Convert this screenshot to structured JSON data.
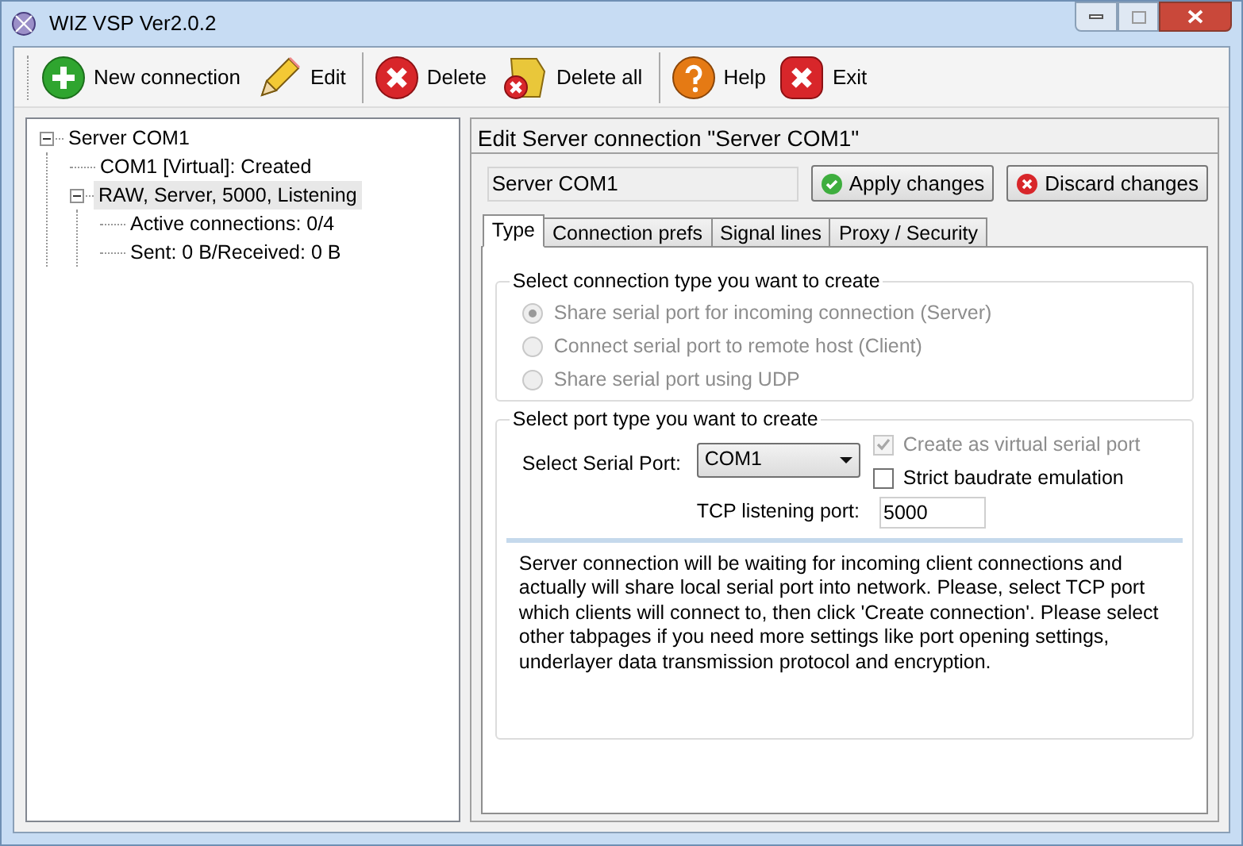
{
  "window": {
    "title": "WIZ VSP Ver2.0.2"
  },
  "toolbar": [
    {
      "label": "New connection",
      "kind": "add",
      "separator_after": false
    },
    {
      "label": "Edit",
      "kind": "edit",
      "separator_after": true
    },
    {
      "label": "Delete",
      "kind": "delete",
      "separator_after": false
    },
    {
      "label": "Delete all",
      "kind": "delete_all",
      "separator_after": true
    },
    {
      "label": "Help",
      "kind": "help",
      "separator_after": false
    },
    {
      "label": "Exit",
      "kind": "exit",
      "separator_after": false
    }
  ],
  "tree": [
    {
      "label": "Server COM1",
      "expanded": true,
      "selected": false,
      "children": [
        {
          "label": "COM1 [Virtual]: Created",
          "selected": false
        },
        {
          "label": "RAW, Server, 5000, Listening",
          "expanded": true,
          "selected": true,
          "children": [
            {
              "label": "Active connections: 0/4",
              "selected": false
            },
            {
              "label": "Sent: 0 B/Received: 0 B",
              "selected": false
            }
          ]
        }
      ]
    }
  ],
  "editor": {
    "title": "Edit Server connection \"Server COM1\"",
    "name_value": "Server COM1",
    "buttons": [
      {
        "label": "Apply changes",
        "kind": "apply"
      },
      {
        "label": "Discard changes",
        "kind": "discard"
      }
    ],
    "tabs": [
      {
        "label": "Type",
        "selected": true
      },
      {
        "label": "Connection prefs",
        "selected": false
      },
      {
        "label": "Signal lines",
        "selected": false
      },
      {
        "label": "Proxy / Security",
        "selected": false
      }
    ],
    "connection_type": {
      "legend": "Select connection type you want to create",
      "options": [
        {
          "label": "Share serial port for incoming connection (Server)",
          "selected": true,
          "disabled": true
        },
        {
          "label": "Connect serial port to remote host (Client)",
          "selected": false,
          "disabled": true
        },
        {
          "label": "Share serial port using UDP",
          "selected": false,
          "disabled": true
        }
      ]
    },
    "port_type": {
      "legend": "Select port type you want to create",
      "serial_port_label": "Select Serial Port:",
      "serial_port_value": "COM1",
      "checkboxes": [
        {
          "label": "Create as virtual serial port",
          "checked": true,
          "disabled": true
        },
        {
          "label": "Strict baudrate emulation",
          "checked": false,
          "disabled": false
        }
      ],
      "tcp_port_label": "TCP listening port:",
      "tcp_port_value": "5000"
    },
    "description": "Server connection will be waiting for incoming client connections and actually will share local serial port into network. Please, select TCP port which clients will connect to, then click 'Create connection'. Please select other tabpages if you need more settings like port opening settings, underlayer data transmission protocol and encryption."
  }
}
